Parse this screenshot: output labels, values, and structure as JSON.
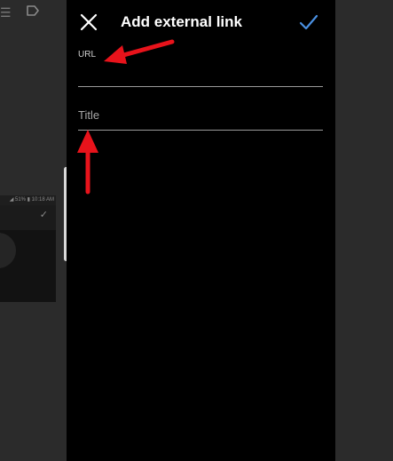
{
  "background_app": {
    "menu_icon": "hamburger-icon",
    "label_icon": "label-tag-icon",
    "thumbnail": {
      "status_text": "◢ 51% ▮ 10:18 AM",
      "check_icon": "checkmark-icon"
    }
  },
  "dialog": {
    "title": "Add external link",
    "close_icon": "close-icon",
    "confirm_icon": "checkmark-icon",
    "accent_color": "#4a90e2",
    "url_field": {
      "label": "URL",
      "value": ""
    },
    "title_field": {
      "placeholder": "Title",
      "value": ""
    }
  },
  "annotations": {
    "arrow_color": "#e8131b"
  }
}
